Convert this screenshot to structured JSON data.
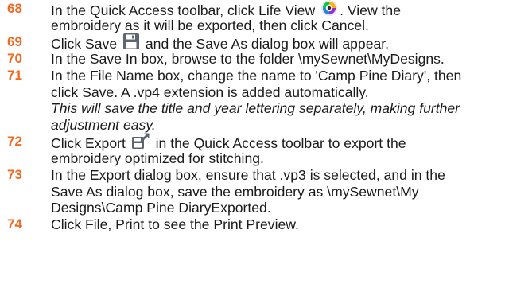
{
  "steps": [
    {
      "num": "68",
      "l1a": "In the Quick Access toolbar, click Life View",
      "l1b": ". View the",
      "l2": "embroidery as it will be exported, then click Cancel."
    },
    {
      "num": "69",
      "l1a": "Click Save",
      "l1b": "and the Save As dialog box will appear."
    },
    {
      "num": "70",
      "l1": "In the Save In box, browse to the folder \\mySewnet\\MyDesigns."
    },
    {
      "num": "71",
      "l1": "In the File Name box, change the name to 'Camp Pine Diary', then",
      "l2": "click Save. A .vp4 extension is added automatically.",
      "l3": "This will save the title and year lettering separately, making further",
      "l4": "adjustment easy."
    },
    {
      "num": "72",
      "l1a": "Click Export",
      "l1b": "in the Quick Access toolbar to export the",
      "l2": "embroidery optimized for stitching."
    },
    {
      "num": "73",
      "l1": "In the Export dialog box, ensure that .vp3 is selected, and in the",
      "l2": "Save As dialog box, save the embroidery as \\mySewnet\\My",
      "l3": "Designs\\Camp Pine DiaryExported."
    },
    {
      "num": "74",
      "l1": "Click File, Print to see the Print Preview."
    }
  ],
  "icons": {
    "life_view": "life-view-icon",
    "save": "save-icon",
    "export": "export-icon"
  },
  "colors": {
    "step_number": "#f26a21",
    "text": "#1b1b1b",
    "icon_gray": "#5b6670"
  }
}
